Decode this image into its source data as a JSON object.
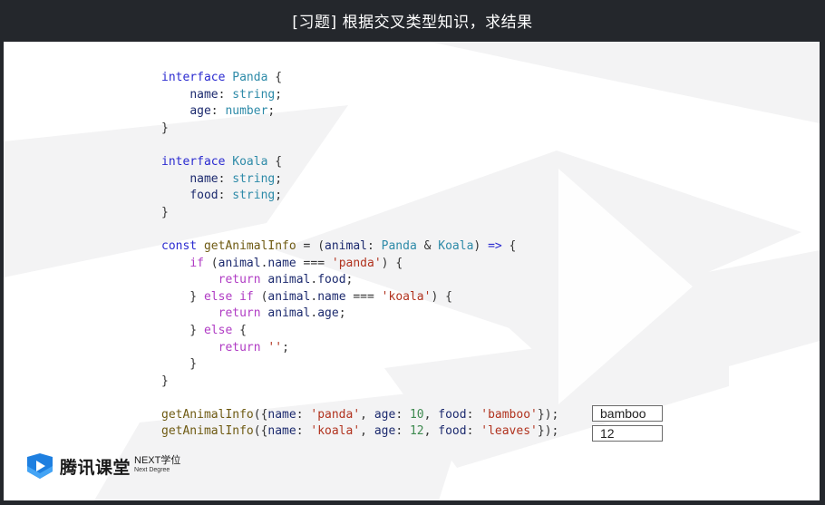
{
  "header": {
    "title": "[习题] 根据交叉类型知识，求结果"
  },
  "code_lines": [
    [
      {
        "t": "interface ",
        "c": "kw"
      },
      {
        "t": "Panda",
        "c": "ty"
      },
      {
        "t": " {",
        "c": ""
      }
    ],
    [
      {
        "t": "    ",
        "c": ""
      },
      {
        "t": "name",
        "c": "prop"
      },
      {
        "t": ": ",
        "c": ""
      },
      {
        "t": "string",
        "c": "ty"
      },
      {
        "t": ";",
        "c": ""
      }
    ],
    [
      {
        "t": "    ",
        "c": ""
      },
      {
        "t": "age",
        "c": "prop"
      },
      {
        "t": ": ",
        "c": ""
      },
      {
        "t": "number",
        "c": "ty"
      },
      {
        "t": ";",
        "c": ""
      }
    ],
    [
      {
        "t": "}",
        "c": ""
      }
    ],
    [],
    [
      {
        "t": "interface ",
        "c": "kw"
      },
      {
        "t": "Koala",
        "c": "ty"
      },
      {
        "t": " {",
        "c": ""
      }
    ],
    [
      {
        "t": "    ",
        "c": ""
      },
      {
        "t": "name",
        "c": "prop"
      },
      {
        "t": ": ",
        "c": ""
      },
      {
        "t": "string",
        "c": "ty"
      },
      {
        "t": ";",
        "c": ""
      }
    ],
    [
      {
        "t": "    ",
        "c": ""
      },
      {
        "t": "food",
        "c": "prop"
      },
      {
        "t": ": ",
        "c": ""
      },
      {
        "t": "string",
        "c": "ty"
      },
      {
        "t": ";",
        "c": ""
      }
    ],
    [
      {
        "t": "}",
        "c": ""
      }
    ],
    [],
    [
      {
        "t": "const ",
        "c": "kw"
      },
      {
        "t": "getAnimalInfo",
        "c": "fn"
      },
      {
        "t": " = (",
        "c": ""
      },
      {
        "t": "animal",
        "c": "prop"
      },
      {
        "t": ": ",
        "c": ""
      },
      {
        "t": "Panda",
        "c": "ty"
      },
      {
        "t": " & ",
        "c": ""
      },
      {
        "t": "Koala",
        "c": "ty"
      },
      {
        "t": ") ",
        "c": ""
      },
      {
        "t": "=>",
        "c": "kw"
      },
      {
        "t": " {",
        "c": ""
      }
    ],
    [
      {
        "t": "    ",
        "c": ""
      },
      {
        "t": "if",
        "c": "kw2"
      },
      {
        "t": " (",
        "c": ""
      },
      {
        "t": "animal",
        "c": "prop"
      },
      {
        "t": ".",
        "c": ""
      },
      {
        "t": "name",
        "c": "prop"
      },
      {
        "t": " === ",
        "c": ""
      },
      {
        "t": "'panda'",
        "c": "str"
      },
      {
        "t": ") {",
        "c": ""
      }
    ],
    [
      {
        "t": "        ",
        "c": ""
      },
      {
        "t": "return ",
        "c": "kw2"
      },
      {
        "t": "animal",
        "c": "prop"
      },
      {
        "t": ".",
        "c": ""
      },
      {
        "t": "food",
        "c": "prop"
      },
      {
        "t": ";",
        "c": ""
      }
    ],
    [
      {
        "t": "    } ",
        "c": ""
      },
      {
        "t": "else if",
        "c": "kw2"
      },
      {
        "t": " (",
        "c": ""
      },
      {
        "t": "animal",
        "c": "prop"
      },
      {
        "t": ".",
        "c": ""
      },
      {
        "t": "name",
        "c": "prop"
      },
      {
        "t": " === ",
        "c": ""
      },
      {
        "t": "'koala'",
        "c": "str"
      },
      {
        "t": ") {",
        "c": ""
      }
    ],
    [
      {
        "t": "        ",
        "c": ""
      },
      {
        "t": "return ",
        "c": "kw2"
      },
      {
        "t": "animal",
        "c": "prop"
      },
      {
        "t": ".",
        "c": ""
      },
      {
        "t": "age",
        "c": "prop"
      },
      {
        "t": ";",
        "c": ""
      }
    ],
    [
      {
        "t": "    } ",
        "c": ""
      },
      {
        "t": "else",
        "c": "kw2"
      },
      {
        "t": " {",
        "c": ""
      }
    ],
    [
      {
        "t": "        ",
        "c": ""
      },
      {
        "t": "return ",
        "c": "kw2"
      },
      {
        "t": "''",
        "c": "str"
      },
      {
        "t": ";",
        "c": ""
      }
    ],
    [
      {
        "t": "    }",
        "c": ""
      }
    ],
    [
      {
        "t": "}",
        "c": ""
      }
    ],
    [],
    [
      {
        "t": "getAnimalInfo",
        "c": "fn"
      },
      {
        "t": "({",
        "c": ""
      },
      {
        "t": "name",
        "c": "prop"
      },
      {
        "t": ": ",
        "c": ""
      },
      {
        "t": "'panda'",
        "c": "str"
      },
      {
        "t": ", ",
        "c": ""
      },
      {
        "t": "age",
        "c": "prop"
      },
      {
        "t": ": ",
        "c": ""
      },
      {
        "t": "10",
        "c": "num"
      },
      {
        "t": ", ",
        "c": ""
      },
      {
        "t": "food",
        "c": "prop"
      },
      {
        "t": ": ",
        "c": ""
      },
      {
        "t": "'bamboo'",
        "c": "str"
      },
      {
        "t": "});",
        "c": ""
      }
    ],
    [
      {
        "t": "getAnimalInfo",
        "c": "fn"
      },
      {
        "t": "({",
        "c": ""
      },
      {
        "t": "name",
        "c": "prop"
      },
      {
        "t": ": ",
        "c": ""
      },
      {
        "t": "'koala'",
        "c": "str"
      },
      {
        "t": ", ",
        "c": ""
      },
      {
        "t": "age",
        "c": "prop"
      },
      {
        "t": ": ",
        "c": ""
      },
      {
        "t": "12",
        "c": "num"
      },
      {
        "t": ", ",
        "c": ""
      },
      {
        "t": "food",
        "c": "prop"
      },
      {
        "t": ": ",
        "c": ""
      },
      {
        "t": "'leaves'",
        "c": "str"
      },
      {
        "t": "});",
        "c": ""
      }
    ]
  ],
  "answers": {
    "first": "bamboo",
    "second": "12"
  },
  "logo": {
    "name": "腾讯课堂",
    "brand": "NEXT学位",
    "tagline": "Next Degree"
  },
  "colors": {
    "keyword": "#2b2bd0",
    "control": "#b03cc4",
    "type": "#2d8aa8",
    "function": "#6e5a12",
    "string": "#b1331f",
    "number": "#3f8a50",
    "property": "#1c2a6e",
    "logo_blue": "#1e7fe0"
  }
}
